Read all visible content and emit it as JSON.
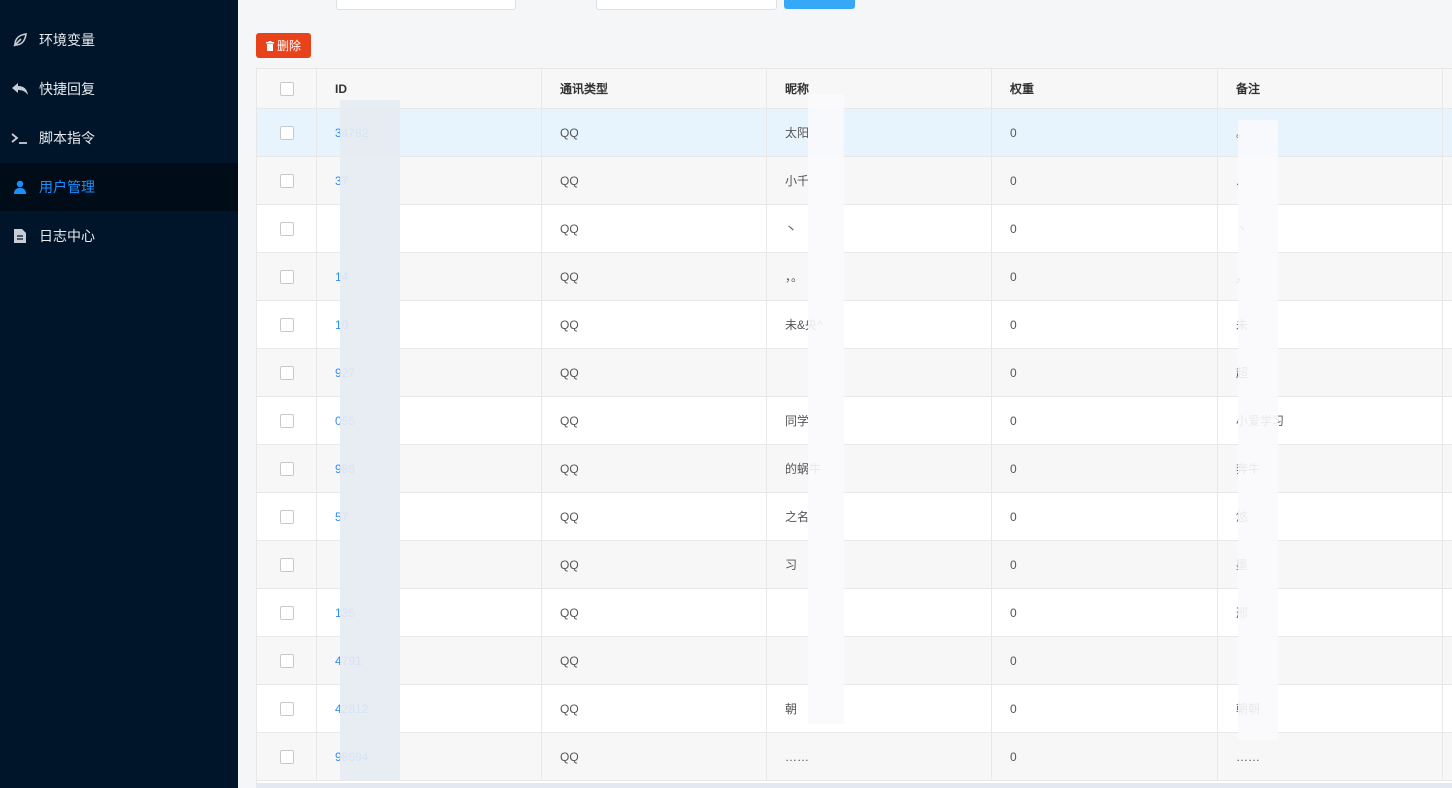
{
  "sidebar": {
    "items": [
      {
        "label": "环境变量",
        "icon": "leaf-icon"
      },
      {
        "label": "快捷回复",
        "icon": "reply-icon"
      },
      {
        "label": "脚本指令",
        "icon": "terminal-icon"
      },
      {
        "label": "用户管理",
        "icon": "user-icon",
        "active": true
      },
      {
        "label": "日志中心",
        "icon": "document-icon"
      }
    ]
  },
  "toolbar": {
    "delete_label": "删除"
  },
  "table": {
    "headers": {
      "id": "ID",
      "type": "通讯类型",
      "nickname": "昵称",
      "weight": "权重",
      "note": "备注"
    },
    "rows": [
      {
        "id": "34782",
        "type": "QQ",
        "nickname": "太阳",
        "weight": "0",
        "note": "。"
      },
      {
        "id": "37",
        "type": "QQ",
        "nickname": "小千",
        "weight": "0",
        "note": "."
      },
      {
        "id": "",
        "type": "QQ",
        "nickname": "丶",
        "weight": "0",
        "note": "丶"
      },
      {
        "id": "14",
        "type": "QQ",
        "nickname": "，。",
        "weight": "0",
        "note": "，"
      },
      {
        "id": "10",
        "type": "QQ",
        "nickname": "未&央^",
        "weight": "0",
        "note": "未"
      },
      {
        "id": "927",
        "type": "QQ",
        "nickname": "",
        "weight": "0",
        "note": "超"
      },
      {
        "id": "055",
        "type": "QQ",
        "nickname": "同学",
        "weight": "0",
        "note": "小爱学习"
      },
      {
        "id": "986",
        "type": "QQ",
        "nickname": "的蜗牛",
        "weight": "0",
        "note": "奔牛"
      },
      {
        "id": "57",
        "type": "QQ",
        "nickname": "之名",
        "weight": "0",
        "note": "悠"
      },
      {
        "id": "",
        "type": "QQ",
        "nickname": "习",
        "weight": "0",
        "note": "墨"
      },
      {
        "id": "135",
        "type": "QQ",
        "nickname": "",
        "weight": "0",
        "note": "邢"
      },
      {
        "id": "4791",
        "type": "QQ",
        "nickname": "",
        "weight": "0",
        "note": ""
      },
      {
        "id": "42812",
        "type": "QQ",
        "nickname": "朝",
        "weight": "0",
        "note": "朝朝"
      },
      {
        "id": "98694",
        "type": "QQ",
        "nickname": "……",
        "weight": "0",
        "note": "……"
      }
    ]
  },
  "colors": {
    "sidebar_bg": "#001529",
    "active": "#1890ff",
    "delete": "#e8421b",
    "link": "#2a8ff7"
  }
}
